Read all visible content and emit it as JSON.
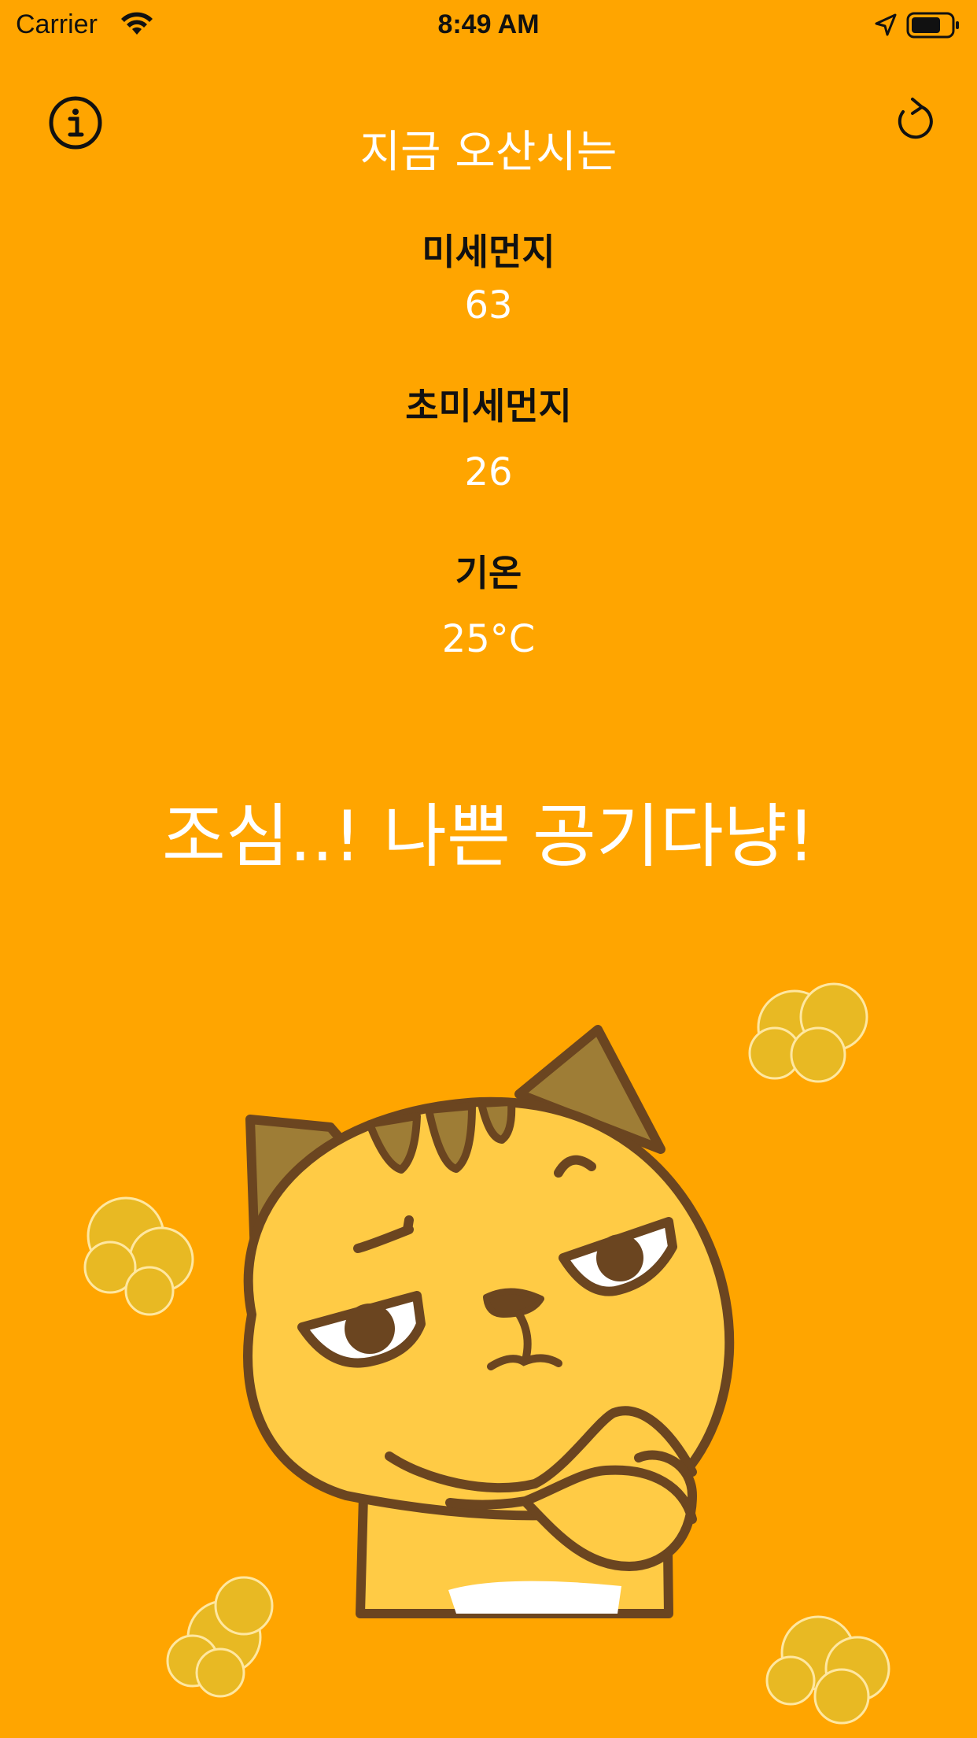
{
  "status_bar": {
    "carrier": "Carrier",
    "time": "8:49 AM",
    "icons": [
      "wifi-icon",
      "location-arrow-icon",
      "battery-icon"
    ]
  },
  "toolbar": {
    "info_icon": "info-icon",
    "refresh_icon": "refresh-icon"
  },
  "headline": "지금 오산시는",
  "metrics": [
    {
      "label": "미세먼지",
      "value": "63"
    },
    {
      "label": "초미세먼지",
      "value": "26"
    },
    {
      "label": "기온",
      "value": "25°C"
    }
  ],
  "message": "조심..! 나쁜 공기다냥!",
  "illustration": "grumpy-cat-with-dust-clouds",
  "colors": {
    "background": "#FFA500",
    "text_primary": "#FFFFFF",
    "text_label": "#111111",
    "cat_body": "#FFCB45",
    "cat_outline": "#6B4520",
    "cat_stripe": "#9E7D36",
    "dust": "#E8B923"
  }
}
